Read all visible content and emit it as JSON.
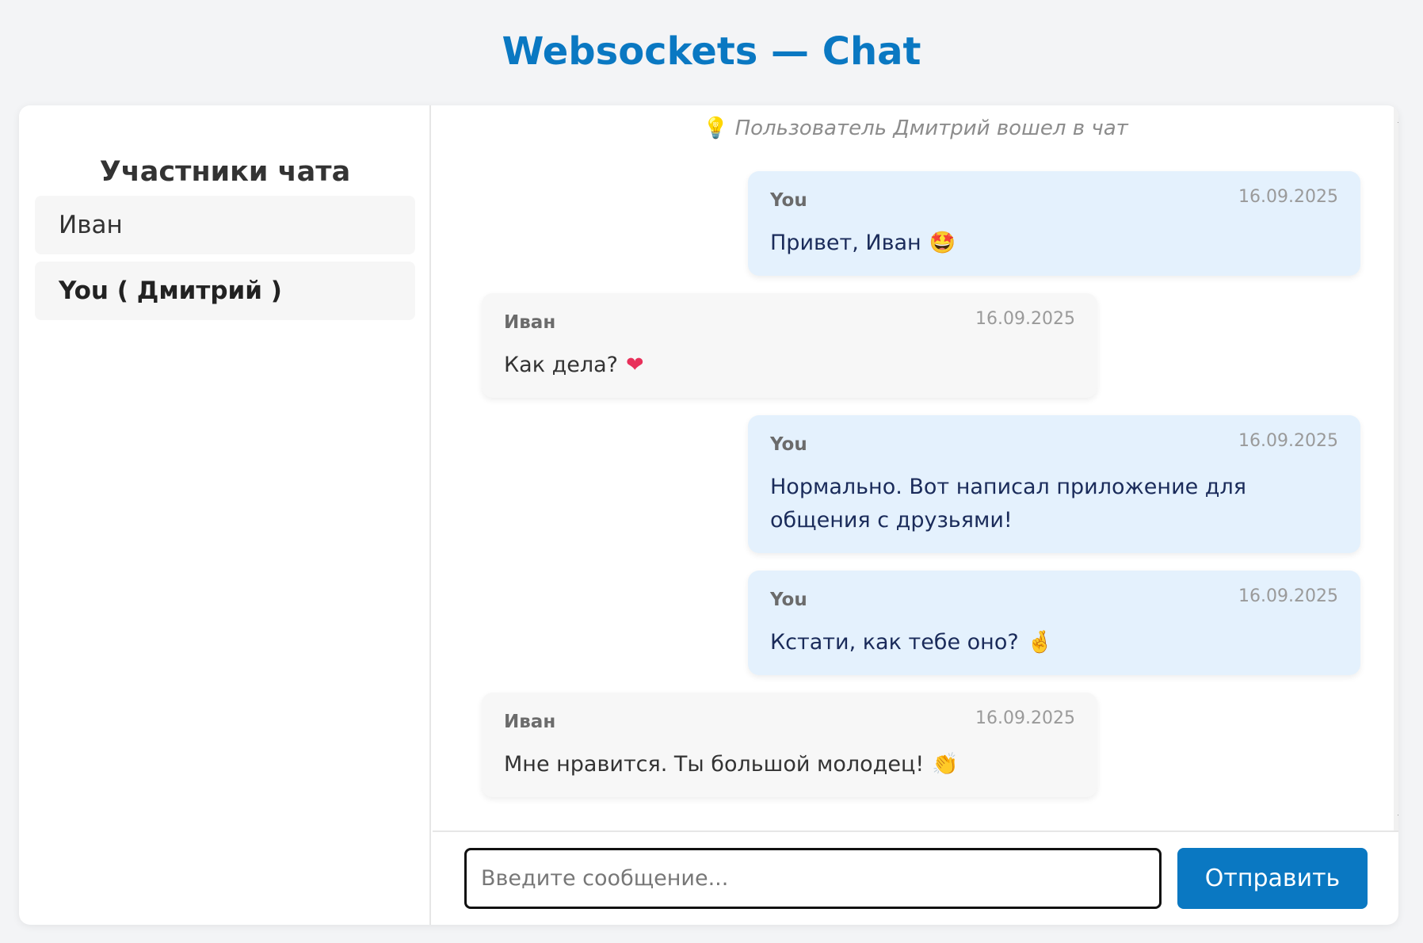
{
  "page_title": "Websockets — Chat",
  "sidebar": {
    "title": "Участники чата",
    "members": [
      {
        "name": "Иван"
      },
      {
        "name": "You ( Дмитрий )"
      }
    ]
  },
  "chat": {
    "system_message": "Пользователь Дмитрий вошел в чат",
    "messages": [
      {
        "author": "You",
        "time": "16.09.2025",
        "text": "Привет, Иван",
        "emoji": "🤩",
        "own": true
      },
      {
        "author": "Иван",
        "time": "16.09.2025",
        "text": "Как дела?",
        "emoji": "❤",
        "own": false
      },
      {
        "author": "You",
        "time": "16.09.2025",
        "text": "Нормально. Вот написал приложение для общения с друзьями!",
        "emoji": "",
        "own": true
      },
      {
        "author": "You",
        "time": "16.09.2025",
        "text": "Кстати, как тебе оно?",
        "emoji": "🤞",
        "own": true
      },
      {
        "author": "Иван",
        "time": "16.09.2025",
        "text": "Мне нравится. Ты большой молодец!",
        "emoji": "👏",
        "own": false
      }
    ]
  },
  "composer": {
    "placeholder": "Введите сообщение...",
    "value": "",
    "send_label": "Отправить"
  },
  "colors": {
    "accent": "#0a78c2",
    "own_bubble": "#e4f1fd",
    "other_bubble": "#f7f7f7"
  },
  "icons": {
    "system_message": "lightbulb-icon",
    "scroll_up": "triangle-up-icon",
    "scroll_down": "triangle-down-icon"
  }
}
